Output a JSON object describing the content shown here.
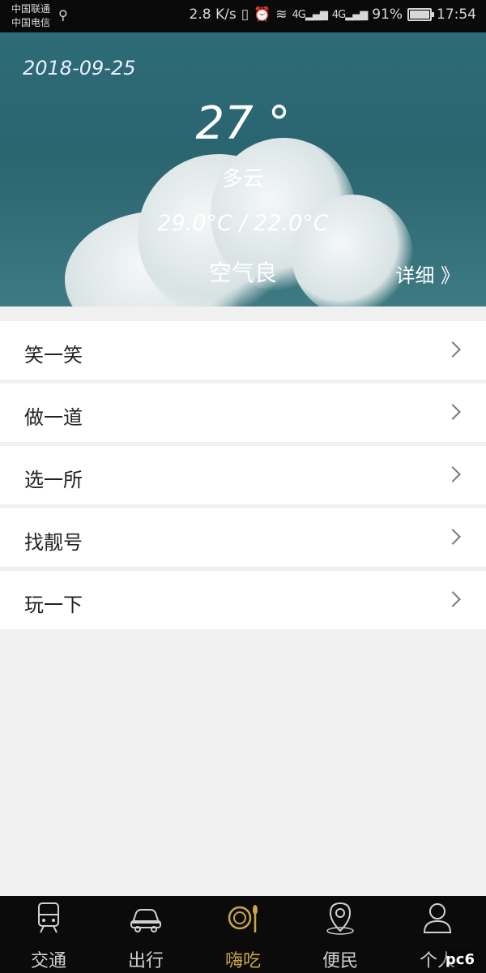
{
  "status_bar": {
    "carrier1": "中国联通",
    "carrier2": "中国电信",
    "speed": "2.8 K/s",
    "net1": "4G",
    "net2": "4G",
    "battery": "91%",
    "battery_level": 0.91,
    "time": "17:54"
  },
  "weather": {
    "date": "2018-09-25",
    "temperature": "27 °",
    "condition": "多云",
    "range": "29.0°C / 22.0°C",
    "air_quality": "空气良",
    "detail_label": "详细 》"
  },
  "menu": [
    {
      "label": "笑一笑"
    },
    {
      "label": "做一道"
    },
    {
      "label": "选一所"
    },
    {
      "label": "找靓号"
    },
    {
      "label": "玩一下"
    }
  ],
  "tabs": [
    {
      "label": "交通",
      "icon": "train-icon"
    },
    {
      "label": "出行",
      "icon": "car-icon"
    },
    {
      "label": "嗨吃",
      "icon": "dining-icon",
      "active": true
    },
    {
      "label": "便民",
      "icon": "location-icon"
    },
    {
      "label": "个人",
      "icon": "person-icon"
    }
  ],
  "watermark": "pc6",
  "colors": {
    "active_tab": "#c9a646",
    "banner": "#2d6b76"
  }
}
